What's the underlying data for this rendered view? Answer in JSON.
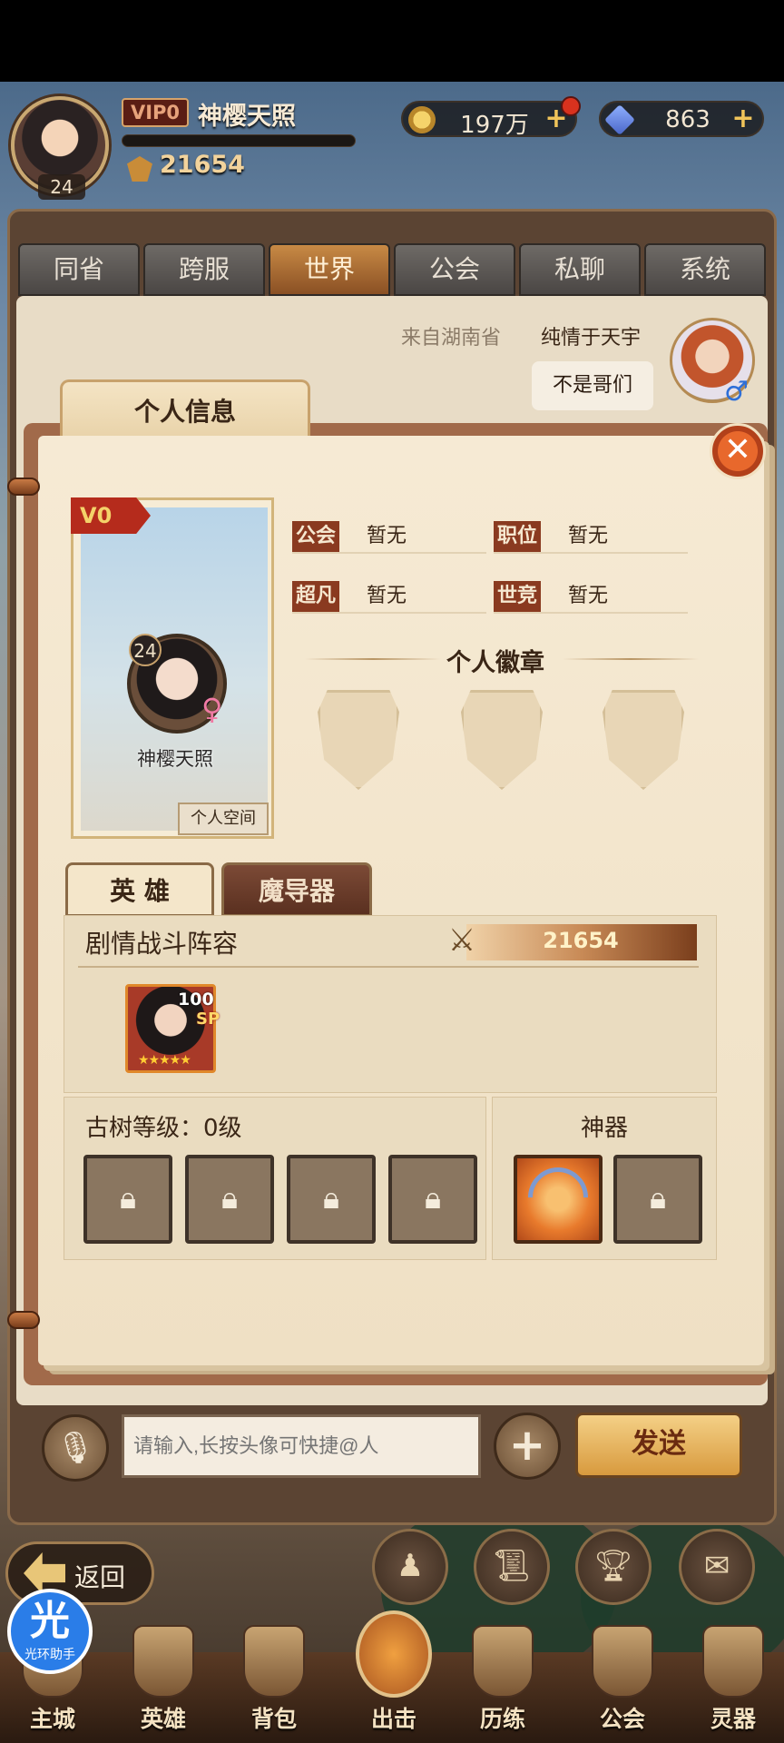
{
  "header": {
    "avatar_level": "24",
    "vip_label": "VIP0",
    "player_name": "神樱天照",
    "power": "21654",
    "gold": "197万",
    "gems": "863"
  },
  "chat_tabs": [
    "同省",
    "跨服",
    "世界",
    "公会",
    "私聊",
    "系统"
  ],
  "active_tab": "世界",
  "message": {
    "from": "来自湖南省",
    "sender": "纯情于天宇",
    "text": "不是哥们",
    "gender_symbol": "♂"
  },
  "profile": {
    "tab_title": "个人信息",
    "vip_ribbon": "V0",
    "level": "24",
    "gender_symbol": "♀",
    "name": "神樱天照",
    "space_button": "个人空间",
    "fields": [
      {
        "label": "公会",
        "value": "暂无"
      },
      {
        "label": "职位",
        "value": "暂无"
      },
      {
        "label": "超凡",
        "value": "暂无"
      },
      {
        "label": "世竞",
        "value": "暂无"
      }
    ],
    "badge_title": "个人徽章",
    "close_symbol": "✕"
  },
  "hero_section": {
    "tabs": [
      "英 雄",
      "魔导器"
    ],
    "team_label": "剧情战斗阵容",
    "team_power": "21654",
    "hero": {
      "level": "100",
      "grade": "SP",
      "stars": "★★★★★"
    },
    "tree_label": "古树等级：0级",
    "artifact_label": "神器"
  },
  "chat_input": {
    "placeholder": "请输入,长按头像可快捷@人",
    "send_label": "发送"
  },
  "bottom": {
    "back_label": "返回",
    "assist_logo": "光",
    "assist_label": "光环助手",
    "nav": [
      "主城",
      "英雄",
      "背包",
      "出击",
      "历练",
      "公会",
      "灵器"
    ]
  },
  "colors": {
    "accent_orange": "#c88a45",
    "vip_red": "#b52b1c",
    "label_brown": "#8a3a20",
    "paper": "#f6ead4"
  }
}
